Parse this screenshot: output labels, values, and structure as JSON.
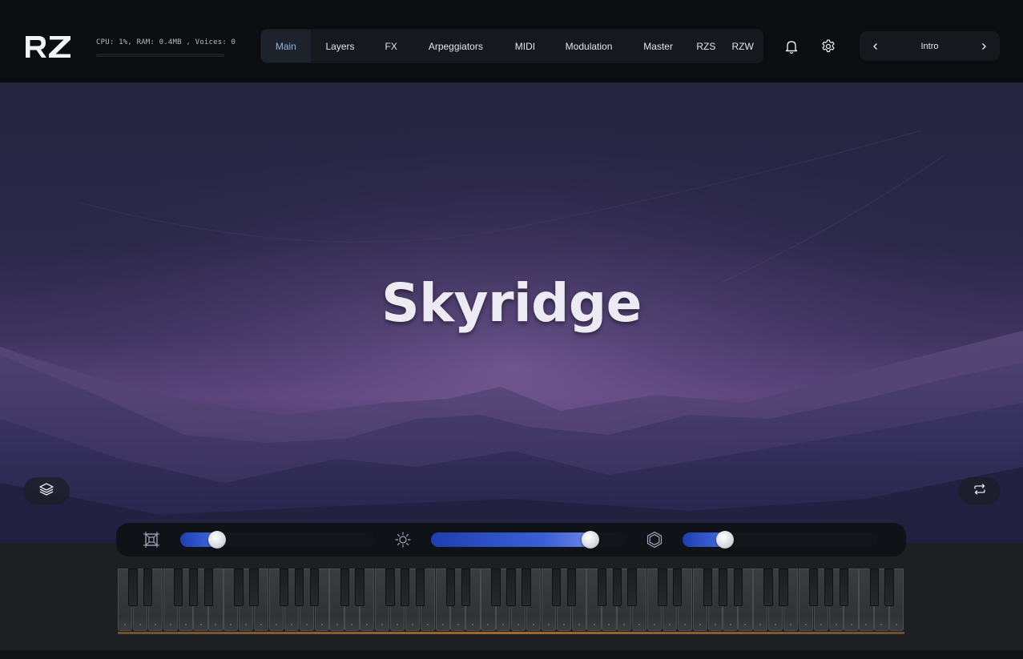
{
  "header": {
    "logo_text": "RZ",
    "stats": "CPU: 1%, RAM: 0.4MB , Voices: 0",
    "tabs": [
      {
        "label": "Main",
        "active": true
      },
      {
        "label": "Layers"
      },
      {
        "label": "FX"
      },
      {
        "label": "Arpeggiators"
      },
      {
        "label": "MIDI"
      },
      {
        "label": "Modulation"
      },
      {
        "label": "Master"
      },
      {
        "label": "RZS"
      },
      {
        "label": "RZW"
      }
    ],
    "icons": {
      "notifications": "bell-icon",
      "settings": "gear-icon"
    },
    "preset": {
      "name": "Intro",
      "prev": "chevron-left-icon",
      "next": "chevron-right-icon"
    }
  },
  "hero": {
    "title": "Skyridge",
    "left_button_icon": "layers-icon",
    "right_button_icon": "cycle-icon"
  },
  "macros": [
    {
      "icon": "frame-icon",
      "value": 0.16
    },
    {
      "icon": "sun-icon",
      "value": 0.85
    },
    {
      "icon": "hexagon-icon",
      "value": 0.19
    }
  ],
  "keyboard": {
    "white_keys": 52
  },
  "colors": {
    "accent": "#8fb2e6",
    "slider_fill": "#2f50c8",
    "hero_top": "#25233f",
    "hero_glow": "#5a4479",
    "keyboard_underline": "#a26a2c"
  }
}
